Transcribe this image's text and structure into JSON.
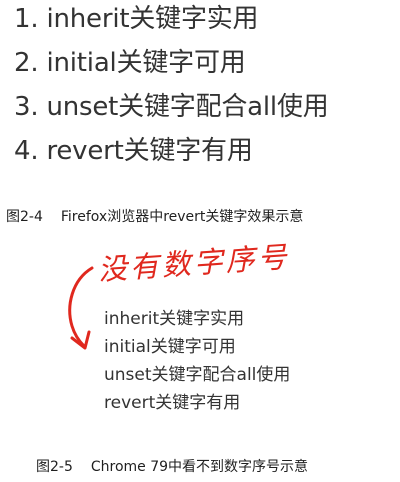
{
  "figure_2_4": {
    "list": [
      "1. inherit关键字实用",
      "2. initial关键字可用",
      "3. unset关键字配合all使用",
      "4. revert关键字有用"
    ],
    "caption_num": "图2-4",
    "caption_text": "Firefox浏览器中revert关键字效果示意"
  },
  "figure_2_5": {
    "annotation": "没有数字序号",
    "list": [
      "inherit关键字实用",
      "initial关键字可用",
      "unset关键字配合all使用",
      "revert关键字有用"
    ],
    "caption_num": "图2-5",
    "caption_text": "Chrome 79中看不到数字序号示意"
  },
  "colors": {
    "annotation": "#e0281e",
    "text": "#333333"
  }
}
